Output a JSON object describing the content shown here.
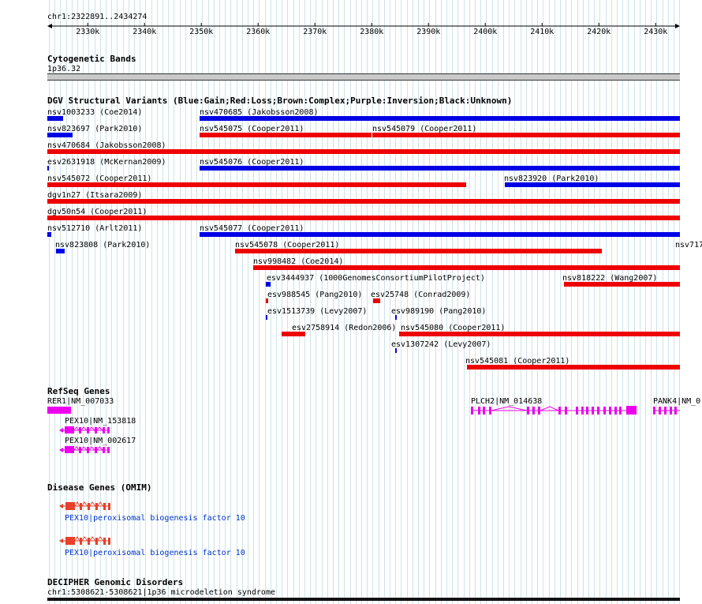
{
  "colors": {
    "gain": "#0000e6",
    "loss": "#ee0000",
    "gene": "#ee00ee",
    "disease": "#e8402a",
    "link": "#0033cc",
    "grid": "#cde3ea"
  },
  "ruler": {
    "position": "chr1:2322891..2434274",
    "ticks": [
      "2330k",
      "2340k",
      "2350k",
      "2360k",
      "2370k",
      "2380k",
      "2390k",
      "2400k",
      "2410k",
      "2420k",
      "2430k"
    ]
  },
  "cytoband": {
    "title": "Cytogenetic Bands",
    "band": "1p36.32"
  },
  "dgv": {
    "title": "DGV Structural Variants (Blue:Gain;Red:Loss;Brown:Complex;Purple:Inversion;Black:Unknown)",
    "features": [
      {
        "label": "nsv1003233 (Coe2014)",
        "type": "gain",
        "start": 2322891,
        "end": 2325700
      },
      {
        "label": "nsv470685 (Jakobsson2008)",
        "type": "gain",
        "start": 2349700,
        "end": 2434274
      },
      {
        "label": "nsv823697 (Park2010)",
        "type": "gain",
        "start": 2322891,
        "end": 2327300
      },
      {
        "label": "nsv545075 (Cooper2011)",
        "type": "loss",
        "start": 2349700,
        "end": 2379950
      },
      {
        "label": "nsv545079 (Cooper2011)",
        "type": "loss",
        "start": 2380050,
        "end": 2434274
      },
      {
        "label": "nsv470684 (Jakobsson2008)",
        "type": "loss",
        "start": 2322891,
        "end": 2434274
      },
      {
        "label": "esv2631918 (McKernan2009)",
        "type": "gain",
        "start": 2322891,
        "end": 2323200
      },
      {
        "label": "nsv545076 (Cooper2011)",
        "type": "gain",
        "start": 2349700,
        "end": 2434274
      },
      {
        "label": "nsv545072 (Cooper2011)",
        "type": "loss",
        "start": 2322891,
        "end": 2396600
      },
      {
        "label": "nsv823920 (Park2010)",
        "type": "gain",
        "start": 2403500,
        "end": 2434274
      },
      {
        "label": "dgv1n27 (Itsara2009)",
        "type": "loss",
        "start": 2322891,
        "end": 2434274
      },
      {
        "label": "dgv50n54 (Cooper2011)",
        "type": "loss",
        "start": 2322891,
        "end": 2434274
      },
      {
        "label": "nsv512710 (Arlt2011)",
        "type": "gain",
        "start": 2322891,
        "end": 2323600
      },
      {
        "label": "nsv545077 (Cooper2011)",
        "type": "gain",
        "start": 2349700,
        "end": 2434274
      },
      {
        "label": "nsv823808 (Park2010)",
        "type": "gain",
        "start": 2324400,
        "end": 2325900
      },
      {
        "label": "nsv545078 (Cooper2011)",
        "type": "loss",
        "start": 2356000,
        "end": 2420600
      },
      {
        "label": "nsv717",
        "type": "gain",
        "start": 2434500,
        "end": 2434700
      },
      {
        "label": "nsv998482 (Coe2014)",
        "type": "loss",
        "start": 2359200,
        "end": 2434274
      },
      {
        "label": "esv3444937 (1000GenomesConsortiumPilotProject)",
        "type": "gain",
        "start": 2361400,
        "end": 2362200
      },
      {
        "label": "nsv818222 (Wang2007)",
        "type": "loss",
        "start": 2413800,
        "end": 2434274
      },
      {
        "label": "esv988545 (Pang2010)",
        "type": "loss",
        "start": 2361400,
        "end": 2361800
      },
      {
        "label": "esv25748 (Conrad2009)",
        "type": "loss",
        "start": 2380200,
        "end": 2381400
      },
      {
        "label": "esv1513739 (Levy2007)",
        "type": "gain",
        "start": 2361400,
        "end": 2361700
      },
      {
        "label": "esv989190 (Pang2010)",
        "type": "gain",
        "start": 2384100,
        "end": 2384400
      },
      {
        "label": "esv2758914 (Redon2006)",
        "type": "loss",
        "start": 2364200,
        "end": 2368400
      },
      {
        "label": "nsv545080 (Cooper2011)",
        "type": "loss",
        "start": 2384900,
        "end": 2434274
      },
      {
        "label": "esv1307242 (Levy2007)",
        "type": "gain",
        "start": 2384100,
        "end": 2384400
      },
      {
        "label": "nsv545081 (Cooper2011)",
        "type": "loss",
        "start": 2396800,
        "end": 2434274
      }
    ]
  },
  "refseq": {
    "title": "RefSeq Genes",
    "genes": [
      {
        "label": "RER1|NM_007033",
        "strand": "+"
      },
      {
        "label": "PEX10|NM_153818",
        "strand": "-"
      },
      {
        "label": "PEX10|NM_002617",
        "strand": "-"
      },
      {
        "label": "PLCH2|NM_014638",
        "strand": "+"
      },
      {
        "label": "PANK4|NM_0",
        "strand": "+"
      }
    ]
  },
  "omim": {
    "title": "Disease Genes (OMIM)",
    "entries": [
      {
        "label": "PEX10|peroxisomal biogenesis factor 10"
      },
      {
        "label": "PEX10|peroxisomal biogenesis factor 10"
      }
    ]
  },
  "decipher": {
    "title": "DECIPHER Genomic Disorders",
    "entry": "chr1:5308621-5308621|1p36 microdeletion syndrome"
  }
}
